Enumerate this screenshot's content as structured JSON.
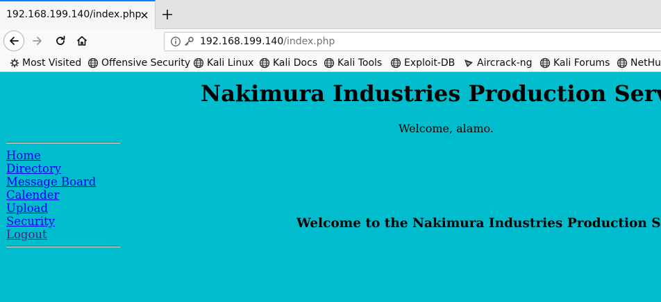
{
  "browser": {
    "tab": {
      "title": "192.168.199.140/index.php"
    },
    "url": {
      "host": "192.168.199.140",
      "path": "/index.php"
    },
    "bookmarks": [
      {
        "label": "Most Visited",
        "icon": "gear-icon"
      },
      {
        "label": "Offensive Security",
        "icon": "globe-icon"
      },
      {
        "label": "Kali Linux",
        "icon": "globe-icon"
      },
      {
        "label": "Kali Docs",
        "icon": "globe-icon"
      },
      {
        "label": "Kali Tools",
        "icon": "globe-icon"
      },
      {
        "label": "Exploit-DB",
        "icon": "globe-icon"
      },
      {
        "label": "Aircrack-ng",
        "icon": "aircrack-icon"
      },
      {
        "label": "Kali Forums",
        "icon": "globe-icon"
      },
      {
        "label": "NetHu",
        "icon": "globe-icon"
      }
    ]
  },
  "page": {
    "background": "#00bccc",
    "title": "Nakimura Industries Production Serv",
    "welcome": "Welcome, alamo.",
    "nav": [
      {
        "label": "Home"
      },
      {
        "label": "Directory"
      },
      {
        "label": "Message Board"
      },
      {
        "label": "Calender"
      },
      {
        "label": "Upload"
      },
      {
        "label": "Security"
      },
      {
        "label": "Logout"
      }
    ],
    "heading": "Welcome to the Nakimura Industries Production S"
  }
}
